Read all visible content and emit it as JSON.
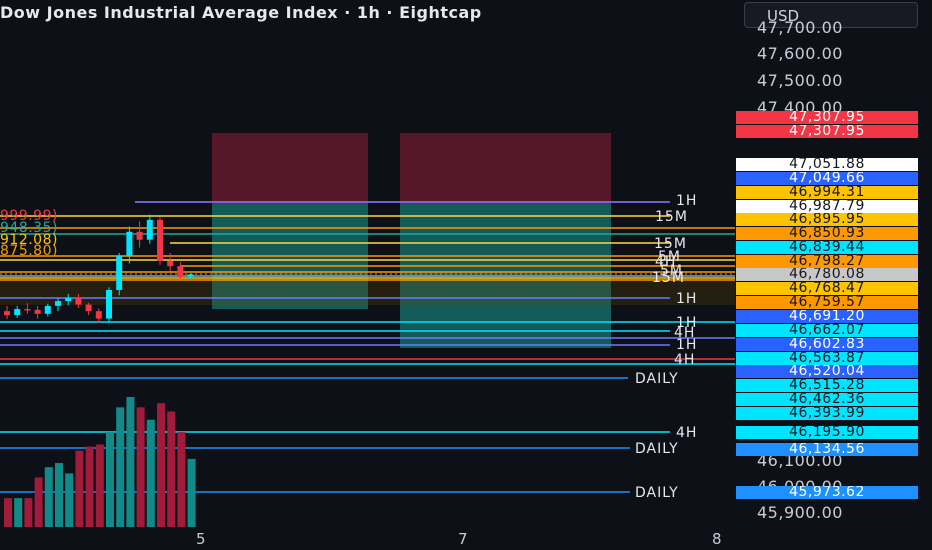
{
  "header": {
    "title": "Dow Jones Industrial Average Index · 1h · Eightcap",
    "currency": "USD"
  },
  "price_scale": {
    "labels": [
      "47,700.00",
      "47,600.00",
      "47,500.00",
      "47,400.00",
      "46,100.00",
      "46,000.00",
      "45,900.00"
    ]
  },
  "price_tags": [
    {
      "text": "47,307.95",
      "bg": "#f23645",
      "fg": "#ffffff"
    },
    {
      "text": "47,307.95",
      "bg": "#f23645",
      "fg": "#ffffff"
    },
    {
      "text": "47,051.88",
      "bg": "#ffffff",
      "fg": "#131722"
    },
    {
      "text": "47,049.66",
      "bg": "#2962ff",
      "fg": "#ffffff"
    },
    {
      "text": "46,994.31",
      "bg": "#ffc300",
      "fg": "#131722"
    },
    {
      "text": "46,987.79",
      "bg": "#ffffff",
      "fg": "#131722"
    },
    {
      "text": "46,895.95",
      "bg": "#ffc300",
      "fg": "#131722"
    },
    {
      "text": "46,850.93",
      "bg": "#ff9800",
      "fg": "#131722"
    },
    {
      "text": "46,839.44",
      "bg": "#00e5ff",
      "fg": "#131722"
    },
    {
      "text": "46,798.27",
      "bg": "#ff9800",
      "fg": "#131722"
    },
    {
      "text": "46,780.08",
      "bg": "#c8c8c8",
      "fg": "#131722"
    },
    {
      "text": "46,768.47",
      "bg": "#ffc300",
      "fg": "#131722"
    },
    {
      "text": "46,759.57",
      "bg": "#ff9800",
      "fg": "#131722"
    },
    {
      "text": "46,691.20",
      "bg": "#2962ff",
      "fg": "#ffffff"
    },
    {
      "text": "46,662.07",
      "bg": "#00e5ff",
      "fg": "#131722"
    },
    {
      "text": "46,602.83",
      "bg": "#2962ff",
      "fg": "#ffffff"
    },
    {
      "text": "46,563.87",
      "bg": "#00e5ff",
      "fg": "#131722"
    },
    {
      "text": "46,520.04",
      "bg": "#2962ff",
      "fg": "#ffffff"
    },
    {
      "text": "46,515.28",
      "bg": "#00e5ff",
      "fg": "#131722"
    },
    {
      "text": "46,462.36",
      "bg": "#00e5ff",
      "fg": "#131722"
    },
    {
      "text": "46,393.99",
      "bg": "#00e5ff",
      "fg": "#131722"
    },
    {
      "text": "46,195.90",
      "bg": "#00e5ff",
      "fg": "#131722"
    },
    {
      "text": "46,134.56",
      "bg": "#1e90ff",
      "fg": "#ffffff"
    },
    {
      "text": "45,973.62",
      "bg": "#1e90ff",
      "fg": "#ffffff"
    }
  ],
  "level_labels": [
    {
      "text": "1H",
      "color": "#8f7bff"
    },
    {
      "text": "15M",
      "color": "#ffd740"
    },
    {
      "text": "15M",
      "color": "#ffd740"
    },
    {
      "text": "5M",
      "color": "#ff9800"
    },
    {
      "text": "4H",
      "color": "#00e5ff"
    },
    {
      "text": "5M",
      "color": "#ff9800"
    },
    {
      "text": "15M",
      "color": "#ffd740"
    },
    {
      "text": "1H",
      "color": "#6a7cff"
    },
    {
      "text": "1H",
      "color": "#6a7cff"
    },
    {
      "text": "4H",
      "color": "#00e5ff"
    },
    {
      "text": "1H",
      "color": "#6a7cff"
    },
    {
      "text": "4H",
      "color": "#00e5ff"
    },
    {
      "text": "DAILY",
      "color": "#1e90ff"
    },
    {
      "text": "4H",
      "color": "#00e5ff"
    },
    {
      "text": "DAILY",
      "color": "#1e90ff"
    },
    {
      "text": "DAILY",
      "color": "#1e90ff"
    }
  ],
  "left_labels": [
    {
      "text": "999.99)",
      "color": "#f23645"
    },
    {
      "text": "948.35)",
      "color": "#26a69a"
    },
    {
      "text": "912.08)",
      "color": "#ffc300"
    },
    {
      "text": "875.80)",
      "color": "#ff9800"
    }
  ],
  "x_axis": {
    "labels": [
      "5",
      "7",
      "8"
    ]
  },
  "colors": {
    "background": "#0d1017",
    "up": "#00e5ff",
    "down": "#f23645",
    "volume_up": "#138a8a",
    "volume_down": "#a01c3a"
  },
  "chart_data": {
    "type": "candlestick",
    "candles": [
      {
        "o": 46640,
        "h": 46660,
        "l": 46610,
        "c": 46625
      },
      {
        "o": 46625,
        "h": 46660,
        "l": 46615,
        "c": 46648
      },
      {
        "o": 46648,
        "h": 46670,
        "l": 46630,
        "c": 46645
      },
      {
        "o": 46645,
        "h": 46660,
        "l": 46612,
        "c": 46630
      },
      {
        "o": 46630,
        "h": 46668,
        "l": 46620,
        "c": 46660
      },
      {
        "o": 46660,
        "h": 46690,
        "l": 46640,
        "c": 46678
      },
      {
        "o": 46678,
        "h": 46705,
        "l": 46662,
        "c": 46690
      },
      {
        "o": 46690,
        "h": 46705,
        "l": 46652,
        "c": 46665
      },
      {
        "o": 46665,
        "h": 46672,
        "l": 46625,
        "c": 46640
      },
      {
        "o": 46640,
        "h": 46650,
        "l": 46595,
        "c": 46612
      },
      {
        "o": 46612,
        "h": 46730,
        "l": 46600,
        "c": 46720
      },
      {
        "o": 46720,
        "h": 46860,
        "l": 46700,
        "c": 46850
      },
      {
        "o": 46850,
        "h": 46960,
        "l": 46820,
        "c": 46940
      },
      {
        "o": 46940,
        "h": 46980,
        "l": 46880,
        "c": 46910
      },
      {
        "o": 46910,
        "h": 47005,
        "l": 46895,
        "c": 46985
      },
      {
        "o": 46985,
        "h": 46995,
        "l": 46815,
        "c": 46830
      },
      {
        "o": 46830,
        "h": 46860,
        "l": 46790,
        "c": 46810
      },
      {
        "o": 46810,
        "h": 46825,
        "l": 46760,
        "c": 46770
      },
      {
        "o": 46770,
        "h": 46782,
        "l": 46762,
        "c": 46779
      }
    ],
    "volume": [
      28,
      28,
      28,
      48,
      58,
      62,
      52,
      74,
      78,
      80,
      92,
      116,
      126,
      116,
      104,
      120,
      112,
      92,
      66
    ],
    "price_range": [
      45870,
      47740
    ],
    "x_ticks": [
      "5",
      "7",
      "8"
    ]
  }
}
